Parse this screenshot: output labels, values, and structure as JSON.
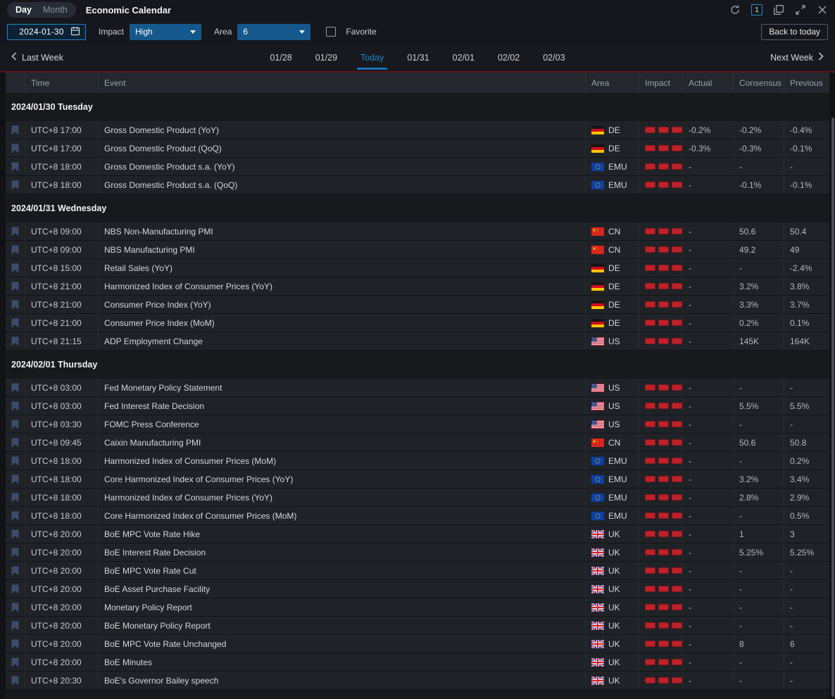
{
  "window": {
    "mode_tabs": [
      {
        "label": "Day",
        "active": true
      },
      {
        "label": "Month",
        "active": false
      }
    ],
    "title": "Economic Calendar",
    "panel_badge": "1",
    "control_icons": [
      "refresh-icon",
      "panel-badge",
      "cascade-windows-icon",
      "expand-icon",
      "close-icon"
    ]
  },
  "filters": {
    "date_value": "2024-01-30",
    "impact_label": "Impact",
    "impact_value": "High",
    "area_label": "Area",
    "area_value": "6",
    "favorite_label": "Favorite",
    "favorite_checked": false,
    "back_button_label": "Back to today"
  },
  "week_nav": {
    "prev_label": "Last Week",
    "next_label": "Next Week",
    "days": [
      "01/28",
      "01/29",
      "Today",
      "01/31",
      "02/01",
      "02/02",
      "02/03"
    ],
    "active_day": "Today"
  },
  "table": {
    "columns": [
      "",
      "Time",
      "Event",
      "Area",
      "Impact",
      "Actual",
      "Consensus",
      "Previous"
    ],
    "sections": [
      {
        "date": "2024/01/30 Tuesday",
        "rows": [
          {
            "time": "UTC+8 17:00",
            "event": "Gross Domestic Product (YoY)",
            "area": "DE",
            "impact": 3,
            "actual": "-0.2%",
            "consensus": "-0.2%",
            "previous": "-0.4%"
          },
          {
            "time": "UTC+8 17:00",
            "event": "Gross Domestic Product (QoQ)",
            "area": "DE",
            "impact": 3,
            "actual": "-0.3%",
            "consensus": "-0.3%",
            "previous": "-0.1%"
          },
          {
            "time": "UTC+8 18:00",
            "event": "Gross Domestic Product s.a. (YoY)",
            "area": "EMU",
            "impact": 3,
            "actual": "-",
            "consensus": "-",
            "previous": "-"
          },
          {
            "time": "UTC+8 18:00",
            "event": "Gross Domestic Product s.a. (QoQ)",
            "area": "EMU",
            "impact": 3,
            "actual": "-",
            "consensus": "-0.1%",
            "previous": "-0.1%"
          }
        ]
      },
      {
        "date": "2024/01/31 Wednesday",
        "rows": [
          {
            "time": "UTC+8 09:00",
            "event": "NBS Non-Manufacturing PMI",
            "area": "CN",
            "impact": 3,
            "actual": "-",
            "consensus": "50.6",
            "previous": "50.4"
          },
          {
            "time": "UTC+8 09:00",
            "event": "NBS Manufacturing PMI",
            "area": "CN",
            "impact": 3,
            "actual": "-",
            "consensus": "49.2",
            "previous": "49"
          },
          {
            "time": "UTC+8 15:00",
            "event": "Retail Sales (YoY)",
            "area": "DE",
            "impact": 3,
            "actual": "-",
            "consensus": "-",
            "previous": "-2.4%"
          },
          {
            "time": "UTC+8 21:00",
            "event": "Harmonized Index of Consumer Prices (YoY)",
            "area": "DE",
            "impact": 3,
            "actual": "-",
            "consensus": "3.2%",
            "previous": "3.8%"
          },
          {
            "time": "UTC+8 21:00",
            "event": "Consumer Price Index (YoY)",
            "area": "DE",
            "impact": 3,
            "actual": "-",
            "consensus": "3.3%",
            "previous": "3.7%"
          },
          {
            "time": "UTC+8 21:00",
            "event": "Consumer Price Index (MoM)",
            "area": "DE",
            "impact": 3,
            "actual": "-",
            "consensus": "0.2%",
            "previous": "0.1%"
          },
          {
            "time": "UTC+8 21:15",
            "event": "ADP Employment Change",
            "area": "US",
            "impact": 3,
            "actual": "-",
            "consensus": "145K",
            "previous": "164K"
          }
        ]
      },
      {
        "date": "2024/02/01 Thursday",
        "rows": [
          {
            "time": "UTC+8 03:00",
            "event": "Fed Monetary Policy Statement",
            "area": "US",
            "impact": 3,
            "actual": "-",
            "consensus": "-",
            "previous": "-"
          },
          {
            "time": "UTC+8 03:00",
            "event": "Fed Interest Rate Decision",
            "area": "US",
            "impact": 3,
            "actual": "-",
            "consensus": "5.5%",
            "previous": "5.5%"
          },
          {
            "time": "UTC+8 03:30",
            "event": "FOMC Press Conference",
            "area": "US",
            "impact": 3,
            "actual": "-",
            "consensus": "-",
            "previous": "-"
          },
          {
            "time": "UTC+8 09:45",
            "event": "Caixin Manufacturing PMI",
            "area": "CN",
            "impact": 3,
            "actual": "-",
            "consensus": "50.6",
            "previous": "50.8"
          },
          {
            "time": "UTC+8 18:00",
            "event": "Harmonized Index of Consumer Prices (MoM)",
            "area": "EMU",
            "impact": 3,
            "actual": "-",
            "consensus": "-",
            "previous": "0.2%"
          },
          {
            "time": "UTC+8 18:00",
            "event": "Core Harmonized Index of Consumer Prices (YoY)",
            "area": "EMU",
            "impact": 3,
            "actual": "-",
            "consensus": "3.2%",
            "previous": "3.4%"
          },
          {
            "time": "UTC+8 18:00",
            "event": "Harmonized Index of Consumer Prices (YoY)",
            "area": "EMU",
            "impact": 3,
            "actual": "-",
            "consensus": "2.8%",
            "previous": "2.9%"
          },
          {
            "time": "UTC+8 18:00",
            "event": "Core Harmonized Index of Consumer Prices (MoM)",
            "area": "EMU",
            "impact": 3,
            "actual": "-",
            "consensus": "-",
            "previous": "0.5%"
          },
          {
            "time": "UTC+8 20:00",
            "event": "BoE MPC Vote Rate Hike",
            "area": "UK",
            "impact": 3,
            "actual": "-",
            "consensus": "1",
            "previous": "3"
          },
          {
            "time": "UTC+8 20:00",
            "event": "BoE Interest Rate Decision",
            "area": "UK",
            "impact": 3,
            "actual": "-",
            "consensus": "5.25%",
            "previous": "5.25%"
          },
          {
            "time": "UTC+8 20:00",
            "event": "BoE MPC Vote Rate Cut",
            "area": "UK",
            "impact": 3,
            "actual": "-",
            "consensus": "-",
            "previous": "-"
          },
          {
            "time": "UTC+8 20:00",
            "event": "BoE Asset Purchase Facility",
            "area": "UK",
            "impact": 3,
            "actual": "-",
            "consensus": "-",
            "previous": "-"
          },
          {
            "time": "UTC+8 20:00",
            "event": "Monetary Policy Report",
            "area": "UK",
            "impact": 3,
            "actual": "-",
            "consensus": "-",
            "previous": "-"
          },
          {
            "time": "UTC+8 20:00",
            "event": "BoE Monetary Policy Report",
            "area": "UK",
            "impact": 3,
            "actual": "-",
            "consensus": "-",
            "previous": "-"
          },
          {
            "time": "UTC+8 20:00",
            "event": "BoE MPC Vote Rate Unchanged",
            "area": "UK",
            "impact": 3,
            "actual": "-",
            "consensus": "8",
            "previous": "6"
          },
          {
            "time": "UTC+8 20:00",
            "event": "BoE Minutes",
            "area": "UK",
            "impact": 3,
            "actual": "-",
            "consensus": "-",
            "previous": "-"
          },
          {
            "time": "UTC+8 20:30",
            "event": "BoE's Governor Bailey speech",
            "area": "UK",
            "impact": 3,
            "actual": "-",
            "consensus": "-",
            "previous": "-"
          }
        ]
      }
    ]
  },
  "colors": {
    "accent_blue": "#1f85cc",
    "select_fill": "#15598c",
    "date_border": "#2486c6",
    "impact_bar_red": "#bf2129",
    "red_divider": "#5c161c",
    "row_bg": "#1f2227",
    "header_bg": "#24272d",
    "bookmark": "#3e4b68"
  }
}
